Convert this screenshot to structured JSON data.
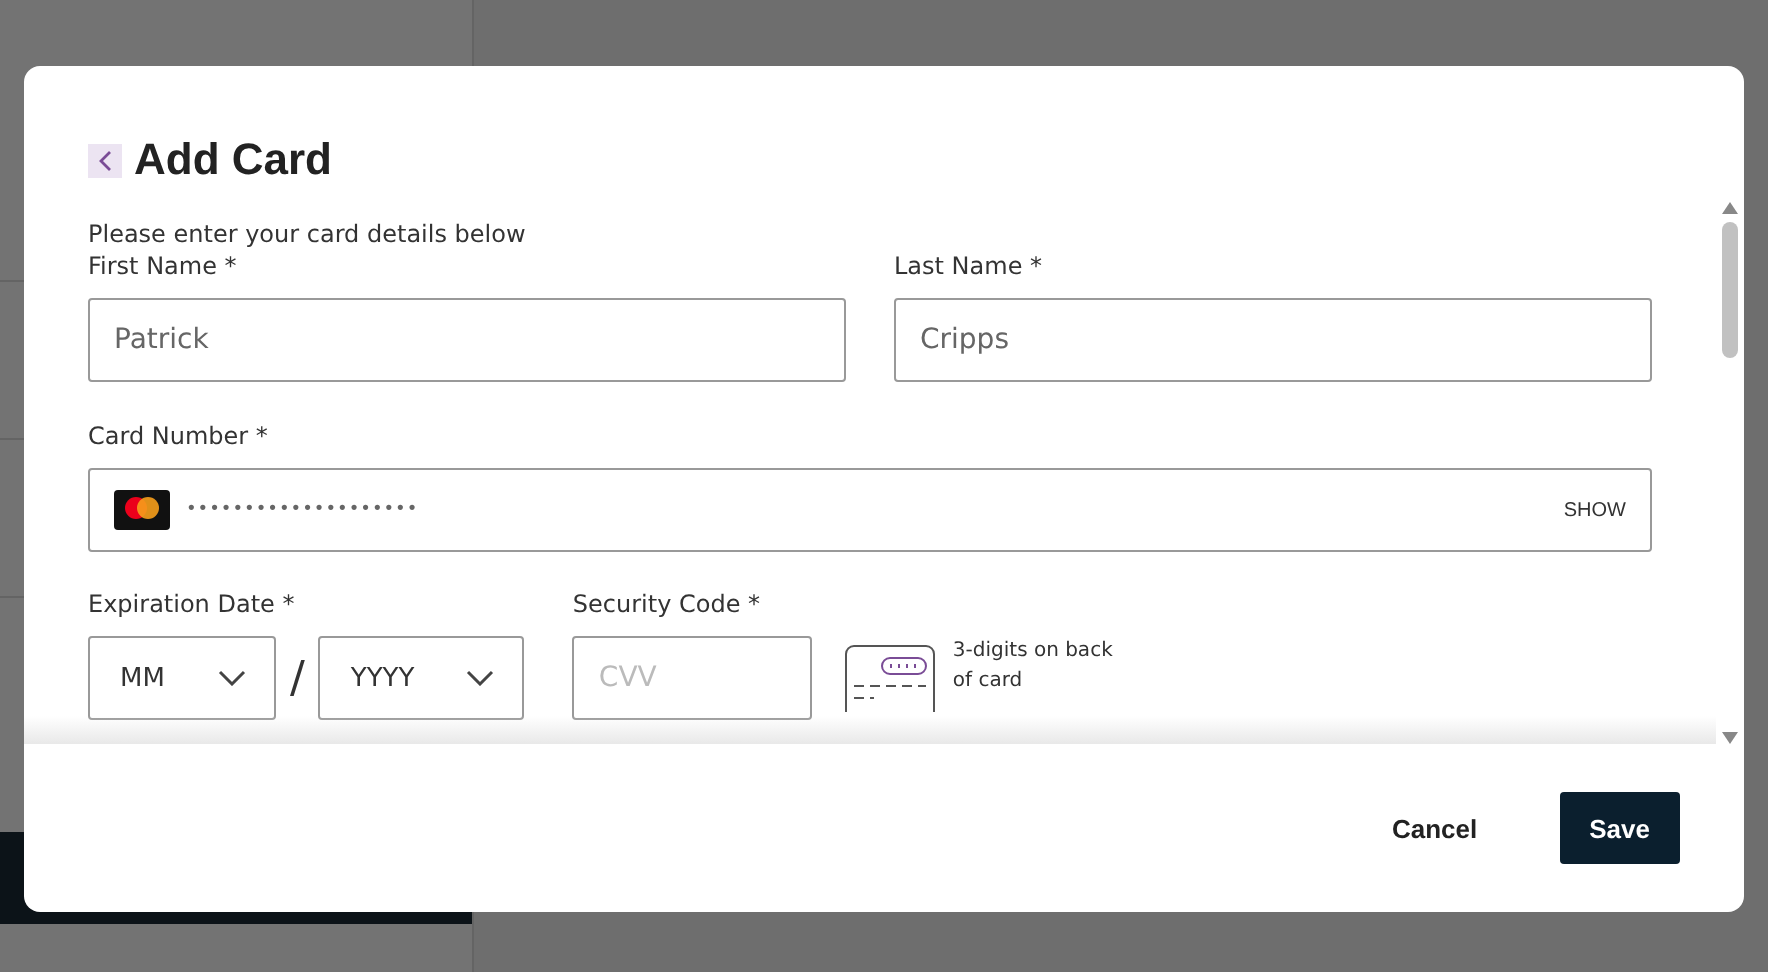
{
  "dialog": {
    "title": "Add Card",
    "intro": "Please enter your card details below",
    "first_name": {
      "label": "First Name *",
      "value": "Patrick"
    },
    "last_name": {
      "label": "Last Name *",
      "value": "Cripps"
    },
    "card_number": {
      "label": "Card Number *",
      "value": "••••••••••••••••••••",
      "toggle": "SHOW"
    },
    "expiration": {
      "label": "Expiration Date *",
      "month": "MM",
      "separator": "/",
      "year": "YYYY"
    },
    "security_code": {
      "label": "Security Code *",
      "placeholder": "CVV",
      "hint": "3-digits on back of card"
    },
    "buttons": [
      {
        "label": "Cancel",
        "kind": "text"
      },
      {
        "label": "Save",
        "kind": "primary"
      }
    ]
  }
}
